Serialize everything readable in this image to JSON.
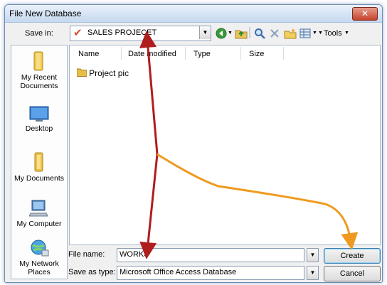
{
  "window": {
    "title": "File New Database",
    "close_glyph": "✕"
  },
  "toolbar": {
    "savein_label": "Save in:",
    "savein_value": "SALES PROJECET",
    "dropdown_glyph": "▼",
    "tools_label": "Tools",
    "icons": [
      "back-icon",
      "up-folder-icon",
      "search-web-icon",
      "delete-icon",
      "new-folder-icon",
      "views-icon"
    ]
  },
  "places": [
    {
      "name": "my-recent-documents",
      "label_line1": "My Recent",
      "label_line2": "Documents"
    },
    {
      "name": "desktop",
      "label_line1": "Desktop",
      "label_line2": ""
    },
    {
      "name": "my-documents",
      "label_line1": "My Documents",
      "label_line2": ""
    },
    {
      "name": "my-computer",
      "label_line1": "My Computer",
      "label_line2": ""
    },
    {
      "name": "my-network-places",
      "label_line1": "My Network",
      "label_line2": "Places"
    }
  ],
  "filelist": {
    "columns": [
      "Name",
      "Date modified",
      "Type",
      "Size"
    ],
    "items": [
      {
        "name": "Project pic"
      }
    ]
  },
  "form": {
    "filename_label": "File name:",
    "filename_value": "WORKS",
    "savetype_label": "Save as type:",
    "savetype_value": "Microsoft Office Access Database",
    "create_label": "Create",
    "cancel_label": "Cancel"
  },
  "annotations": {
    "arrow_red": "#b01d1d",
    "arrow_orange": "#ef9a1f"
  }
}
